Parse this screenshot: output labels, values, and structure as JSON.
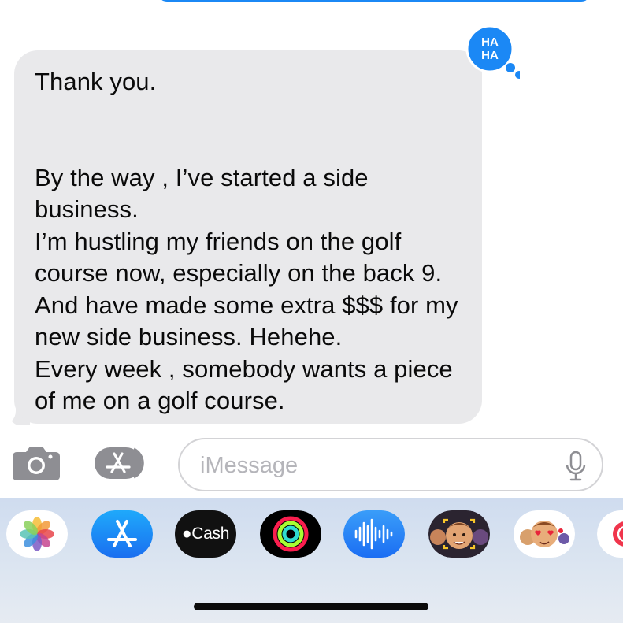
{
  "conversation": {
    "received_message": {
      "text": "Thank you.\n\n\nBy the way , I’ve started a side business.\nI’m hustling my friends on the golf course now, especially on the back 9. And have made some extra $$$ for my new side business.  Hehehe.\nEvery week , somebody wants a piece of me on a golf course.",
      "tapback": "HA HA",
      "tapback_color": "#1b88f5"
    },
    "bubble_color": "#e9e9eb"
  },
  "composer": {
    "placeholder": "iMessage",
    "value": ""
  },
  "app_drawer": {
    "apps": [
      {
        "name": "photos-icon"
      },
      {
        "name": "app-store-icon"
      },
      {
        "name": "apple-cash-icon",
        "label": "Cash"
      },
      {
        "name": "activity-icon"
      },
      {
        "name": "audio-message-icon"
      },
      {
        "name": "memoji-icon"
      },
      {
        "name": "memoji-stickers-icon"
      },
      {
        "name": "more-app-icon"
      }
    ]
  },
  "colors": {
    "accent_blue": "#1b88f5",
    "icon_gray": "#8e8e93"
  }
}
